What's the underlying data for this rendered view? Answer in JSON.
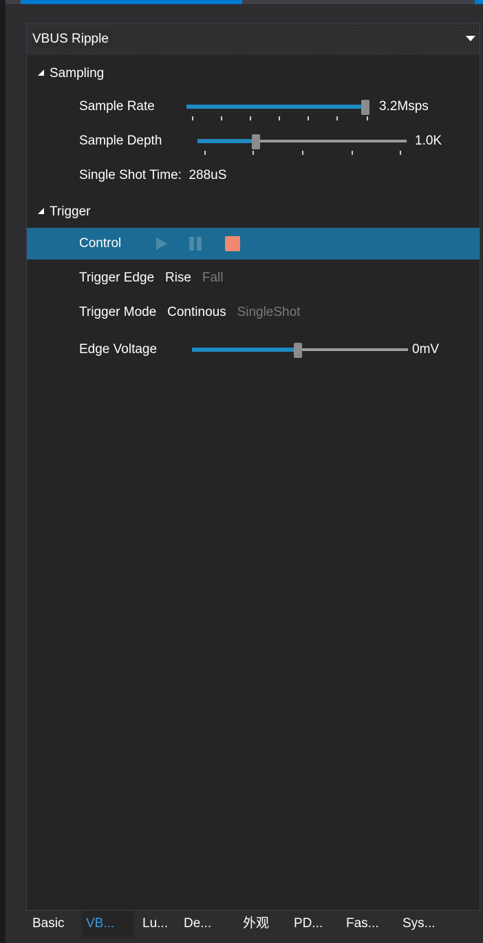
{
  "panel": {
    "title": "VBUS Ripple"
  },
  "sampling": {
    "header": "Sampling",
    "sample_rate": {
      "label": "Sample Rate",
      "value": "3.2Msps",
      "level": 1.0
    },
    "sample_depth": {
      "label": "Sample Depth",
      "value": "1.0K",
      "level": 0.27
    },
    "single_shot_time": {
      "label": "Single Shot Time:",
      "value": "288uS"
    }
  },
  "trigger": {
    "header": "Trigger",
    "control": {
      "label": "Control",
      "icons": [
        "play-icon",
        "pause-icon",
        "stop-icon"
      ]
    },
    "trigger_edge": {
      "label": "Trigger Edge",
      "options": [
        "Rise",
        "Fall"
      ],
      "selected": "Rise"
    },
    "trigger_mode": {
      "label": "Trigger Mode",
      "options": [
        "Continous",
        "SingleShot"
      ],
      "selected": "Continous"
    },
    "edge_voltage": {
      "label": "Edge Voltage",
      "value": "0mV",
      "level": 0.49
    }
  },
  "tabs": [
    "Basic",
    "VB...",
    "Lu...",
    "De...",
    "外观",
    "PD...",
    "Fas...",
    "Sys..."
  ],
  "active_tab": "VB...",
  "colors": {
    "accent": "#007acc",
    "slider_fill": "#1e8ac4",
    "selected_row": "#1c6b94",
    "stop": "#f08872",
    "inactive_text": "#7a7a7a",
    "active_tab_text": "#3a9be0"
  }
}
